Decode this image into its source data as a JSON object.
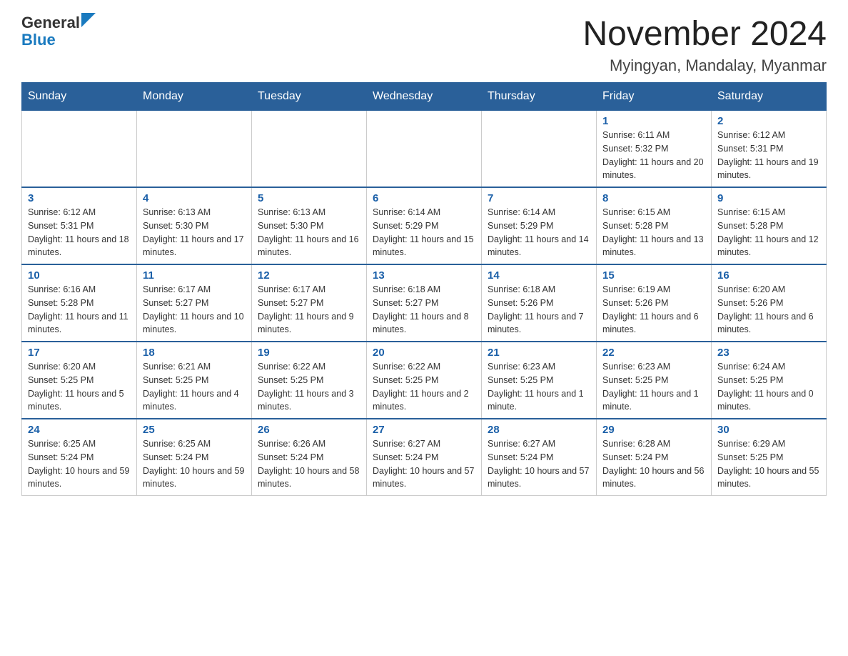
{
  "logo": {
    "general": "General",
    "blue": "Blue",
    "alt": "GeneralBlue logo"
  },
  "title": "November 2024",
  "subtitle": "Myingyan, Mandalay, Myanmar",
  "weekdays": [
    "Sunday",
    "Monday",
    "Tuesday",
    "Wednesday",
    "Thursday",
    "Friday",
    "Saturday"
  ],
  "weeks": [
    [
      {
        "day": "",
        "info": ""
      },
      {
        "day": "",
        "info": ""
      },
      {
        "day": "",
        "info": ""
      },
      {
        "day": "",
        "info": ""
      },
      {
        "day": "",
        "info": ""
      },
      {
        "day": "1",
        "info": "Sunrise: 6:11 AM\nSunset: 5:32 PM\nDaylight: 11 hours and 20 minutes."
      },
      {
        "day": "2",
        "info": "Sunrise: 6:12 AM\nSunset: 5:31 PM\nDaylight: 11 hours and 19 minutes."
      }
    ],
    [
      {
        "day": "3",
        "info": "Sunrise: 6:12 AM\nSunset: 5:31 PM\nDaylight: 11 hours and 18 minutes."
      },
      {
        "day": "4",
        "info": "Sunrise: 6:13 AM\nSunset: 5:30 PM\nDaylight: 11 hours and 17 minutes."
      },
      {
        "day": "5",
        "info": "Sunrise: 6:13 AM\nSunset: 5:30 PM\nDaylight: 11 hours and 16 minutes."
      },
      {
        "day": "6",
        "info": "Sunrise: 6:14 AM\nSunset: 5:29 PM\nDaylight: 11 hours and 15 minutes."
      },
      {
        "day": "7",
        "info": "Sunrise: 6:14 AM\nSunset: 5:29 PM\nDaylight: 11 hours and 14 minutes."
      },
      {
        "day": "8",
        "info": "Sunrise: 6:15 AM\nSunset: 5:28 PM\nDaylight: 11 hours and 13 minutes."
      },
      {
        "day": "9",
        "info": "Sunrise: 6:15 AM\nSunset: 5:28 PM\nDaylight: 11 hours and 12 minutes."
      }
    ],
    [
      {
        "day": "10",
        "info": "Sunrise: 6:16 AM\nSunset: 5:28 PM\nDaylight: 11 hours and 11 minutes."
      },
      {
        "day": "11",
        "info": "Sunrise: 6:17 AM\nSunset: 5:27 PM\nDaylight: 11 hours and 10 minutes."
      },
      {
        "day": "12",
        "info": "Sunrise: 6:17 AM\nSunset: 5:27 PM\nDaylight: 11 hours and 9 minutes."
      },
      {
        "day": "13",
        "info": "Sunrise: 6:18 AM\nSunset: 5:27 PM\nDaylight: 11 hours and 8 minutes."
      },
      {
        "day": "14",
        "info": "Sunrise: 6:18 AM\nSunset: 5:26 PM\nDaylight: 11 hours and 7 minutes."
      },
      {
        "day": "15",
        "info": "Sunrise: 6:19 AM\nSunset: 5:26 PM\nDaylight: 11 hours and 6 minutes."
      },
      {
        "day": "16",
        "info": "Sunrise: 6:20 AM\nSunset: 5:26 PM\nDaylight: 11 hours and 6 minutes."
      }
    ],
    [
      {
        "day": "17",
        "info": "Sunrise: 6:20 AM\nSunset: 5:25 PM\nDaylight: 11 hours and 5 minutes."
      },
      {
        "day": "18",
        "info": "Sunrise: 6:21 AM\nSunset: 5:25 PM\nDaylight: 11 hours and 4 minutes."
      },
      {
        "day": "19",
        "info": "Sunrise: 6:22 AM\nSunset: 5:25 PM\nDaylight: 11 hours and 3 minutes."
      },
      {
        "day": "20",
        "info": "Sunrise: 6:22 AM\nSunset: 5:25 PM\nDaylight: 11 hours and 2 minutes."
      },
      {
        "day": "21",
        "info": "Sunrise: 6:23 AM\nSunset: 5:25 PM\nDaylight: 11 hours and 1 minute."
      },
      {
        "day": "22",
        "info": "Sunrise: 6:23 AM\nSunset: 5:25 PM\nDaylight: 11 hours and 1 minute."
      },
      {
        "day": "23",
        "info": "Sunrise: 6:24 AM\nSunset: 5:25 PM\nDaylight: 11 hours and 0 minutes."
      }
    ],
    [
      {
        "day": "24",
        "info": "Sunrise: 6:25 AM\nSunset: 5:24 PM\nDaylight: 10 hours and 59 minutes."
      },
      {
        "day": "25",
        "info": "Sunrise: 6:25 AM\nSunset: 5:24 PM\nDaylight: 10 hours and 59 minutes."
      },
      {
        "day": "26",
        "info": "Sunrise: 6:26 AM\nSunset: 5:24 PM\nDaylight: 10 hours and 58 minutes."
      },
      {
        "day": "27",
        "info": "Sunrise: 6:27 AM\nSunset: 5:24 PM\nDaylight: 10 hours and 57 minutes."
      },
      {
        "day": "28",
        "info": "Sunrise: 6:27 AM\nSunset: 5:24 PM\nDaylight: 10 hours and 57 minutes."
      },
      {
        "day": "29",
        "info": "Sunrise: 6:28 AM\nSunset: 5:24 PM\nDaylight: 10 hours and 56 minutes."
      },
      {
        "day": "30",
        "info": "Sunrise: 6:29 AM\nSunset: 5:25 PM\nDaylight: 10 hours and 55 minutes."
      }
    ]
  ]
}
